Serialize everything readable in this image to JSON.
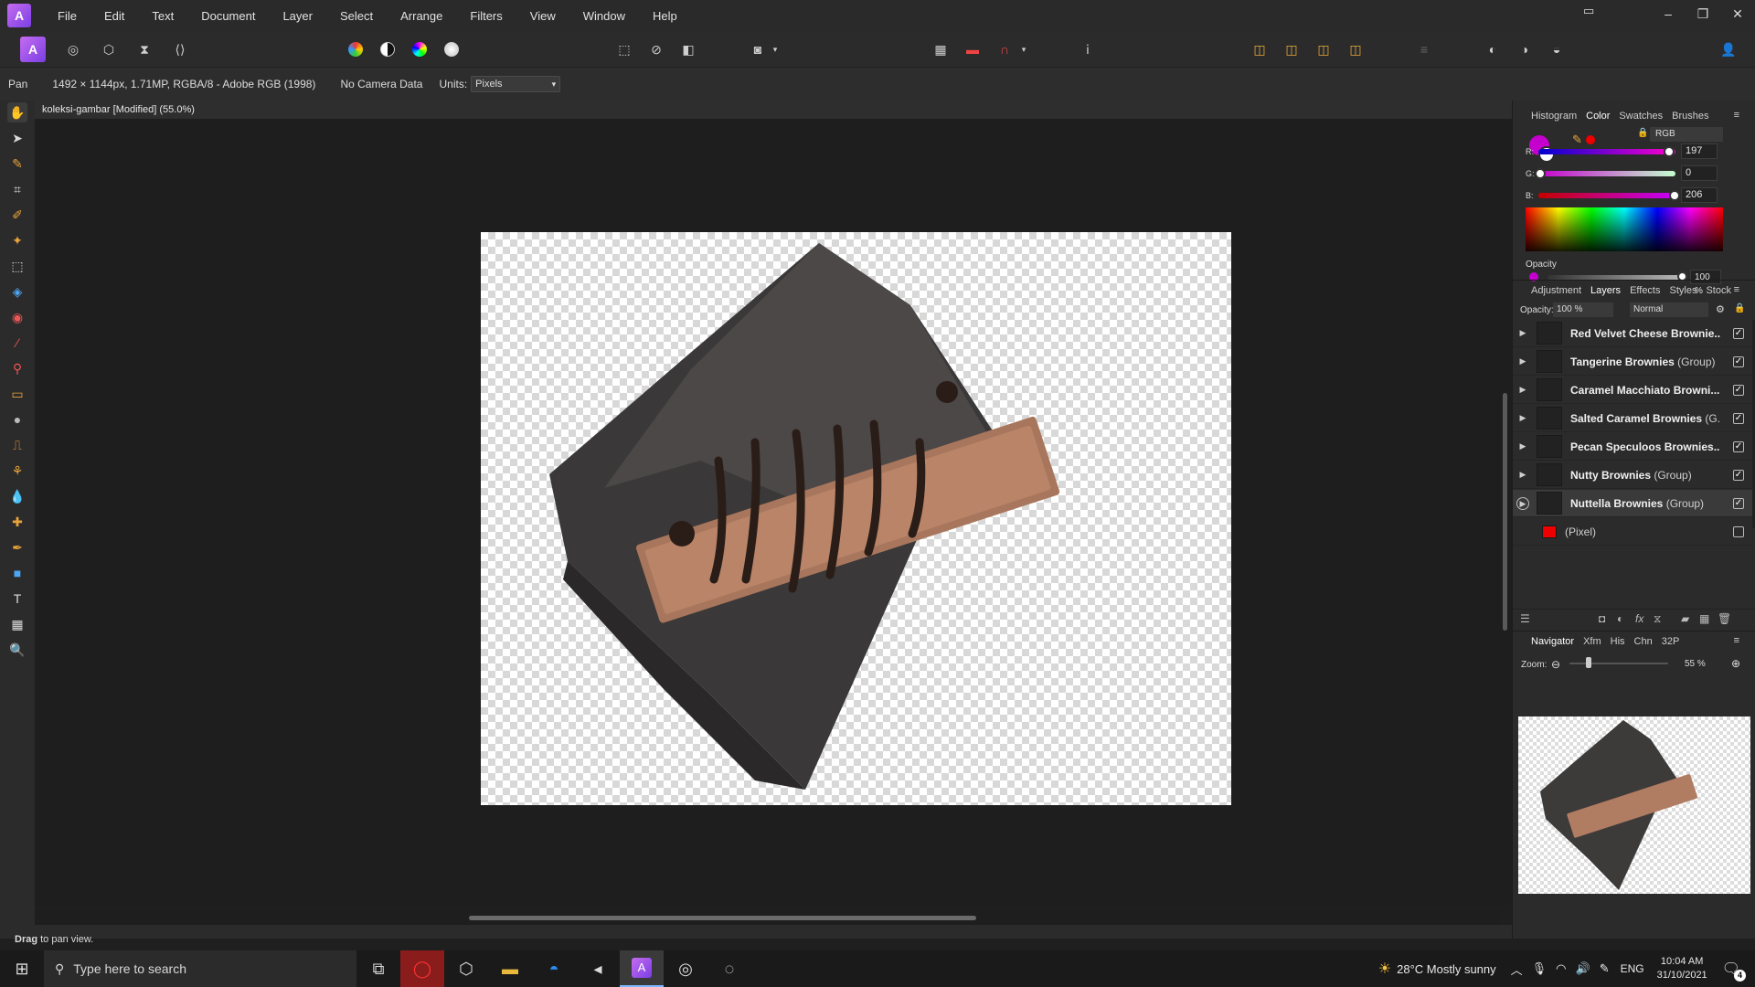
{
  "menu": [
    "File",
    "Edit",
    "Text",
    "Document",
    "Layer",
    "Select",
    "Arrange",
    "Filters",
    "View",
    "Window",
    "Help"
  ],
  "context": {
    "tool": "Pan",
    "doc_info": "1492 × 1144px, 1.71MP, RGBA/8 - Adobe RGB (1998)",
    "camera": "No Camera Data",
    "units_label": "Units:",
    "units_value": "Pixels"
  },
  "document": {
    "tab_title": "koleksi-gambar [Modified] (55.0%)"
  },
  "status": {
    "bold": "Drag",
    "rest": " to pan view."
  },
  "color_panel": {
    "tabs": [
      "Histogram",
      "Color",
      "Swatches",
      "Brushes"
    ],
    "active_tab": "Color",
    "model": "RGB",
    "r_label": "R:",
    "r": 197,
    "g_label": "G:",
    "g": 0,
    "b_label": "B:",
    "b": 206,
    "opacity_label": "Opacity",
    "opacity": "100 %",
    "swatch": "#c500ce"
  },
  "layers_panel": {
    "tabs": [
      "Adjustment",
      "Layers",
      "Effects",
      "Styles",
      "Stock"
    ],
    "active_tab": "Layers",
    "opacity_label": "Opacity:",
    "opacity": "100 %",
    "blend": "Normal",
    "layers": [
      {
        "name": "Red Velvet Cheese Brownie...",
        "suffix": "",
        "checked": true
      },
      {
        "name": "Tangerine Brownies",
        "suffix": " (Group)",
        "checked": true
      },
      {
        "name": "Caramel Macchiato Browni...",
        "suffix": "",
        "checked": true
      },
      {
        "name": "Salted Caramel Brownies",
        "suffix": " (G...",
        "checked": true
      },
      {
        "name": "Pecan Speculoos Brownies...",
        "suffix": "",
        "checked": true
      },
      {
        "name": "Nutty Brownies",
        "suffix": " (Group)",
        "checked": true
      },
      {
        "name": "Nuttella Brownies",
        "suffix": " (Group)",
        "checked": true
      },
      {
        "name": "",
        "suffix": "(Pixel)",
        "checked": false
      }
    ]
  },
  "navigator": {
    "tabs": [
      "Navigator",
      "Xfm",
      "His",
      "Chn",
      "32P"
    ],
    "active_tab": "Navigator",
    "zoom_label": "Zoom:",
    "zoom": "55 %"
  },
  "taskbar": {
    "search_placeholder": "Type here to search",
    "weather": "28°C  Mostly sunny",
    "lang": "ENG",
    "time": "10:04 AM",
    "date": "31/10/2021",
    "notif_count": "4"
  }
}
